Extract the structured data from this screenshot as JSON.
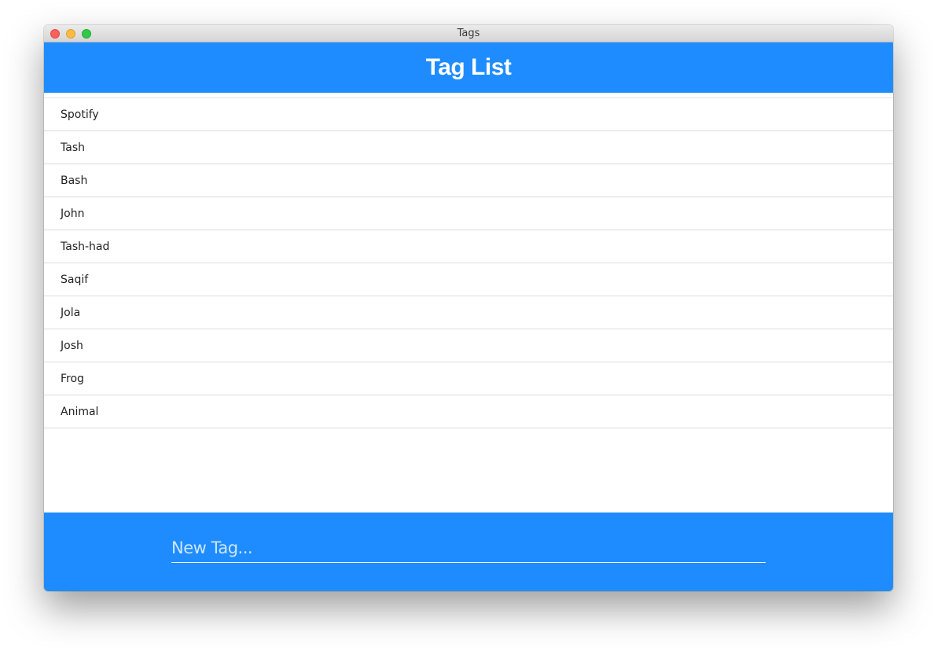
{
  "window": {
    "title": "Tags"
  },
  "header": {
    "title": "Tag List"
  },
  "tags": [
    "Spotify",
    "Tash",
    "Bash",
    "John",
    "Tash-had",
    "Saqif",
    "Jola",
    "Josh",
    "Frog",
    "Animal"
  ],
  "footer": {
    "input": {
      "value": "",
      "placeholder": "New Tag..."
    }
  },
  "colors": {
    "accent": "#1e8cff",
    "header_text": "#ffffff",
    "row_text": "#222222",
    "divider": "#dcdcdc",
    "close": "#fc605c",
    "minimize": "#fdbc40",
    "zoom": "#34c84a"
  },
  "icons": {
    "close": "close-icon",
    "minimize": "minimize-icon",
    "zoom": "zoom-icon"
  }
}
